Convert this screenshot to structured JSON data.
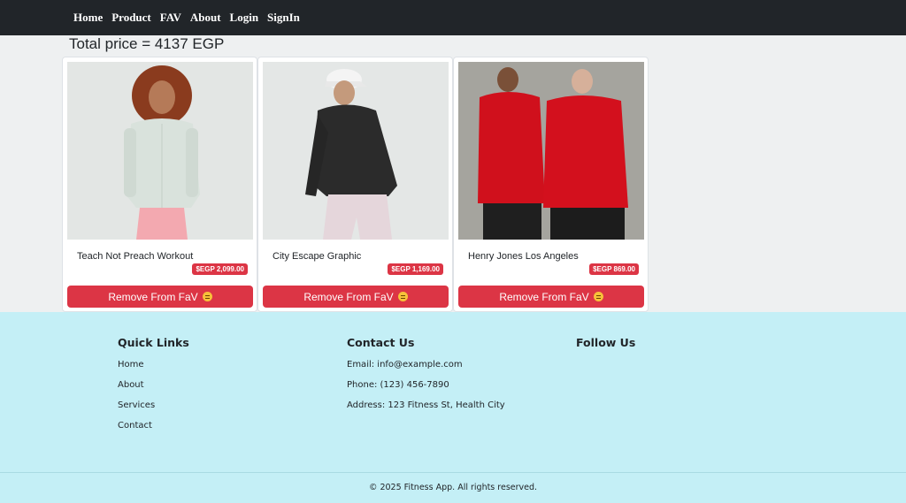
{
  "nav": {
    "links": [
      "Home",
      "Product",
      "FAV",
      "About",
      "Login",
      "SignIn"
    ]
  },
  "total": {
    "label": "Total price = 4137 EGP"
  },
  "products": [
    {
      "title": "Teach Not Preach Workout",
      "price": "$EGP 2,099.00",
      "button": "Remove From FaV",
      "icon": "sad-face-emoji"
    },
    {
      "title": "City Escape Graphic",
      "price": "$EGP 1,169.00",
      "button": "Remove From FaV",
      "icon": "sad-face-emoji"
    },
    {
      "title": "Henry Jones Los Angeles",
      "price": "$EGP 869.00",
      "button": "Remove From FaV",
      "icon": "sad-face-emoji"
    }
  ],
  "footer": {
    "quick_links": {
      "heading": "Quick Links",
      "items": [
        "Home",
        "About",
        "Services",
        "Contact"
      ]
    },
    "contact": {
      "heading": "Contact Us",
      "email": "Email: info@example.com",
      "phone": "Phone: (123) 456-7890",
      "address": "Address: 123 Fitness St, Health City"
    },
    "follow": {
      "heading": "Follow Us"
    },
    "copyright": "© 2025 Fitness App. All rights reserved."
  },
  "colors": {
    "navbar": "#212529",
    "accent_red": "#dc3545",
    "footer_bg": "#c4eff6",
    "page_bg": "#eef0f1"
  }
}
